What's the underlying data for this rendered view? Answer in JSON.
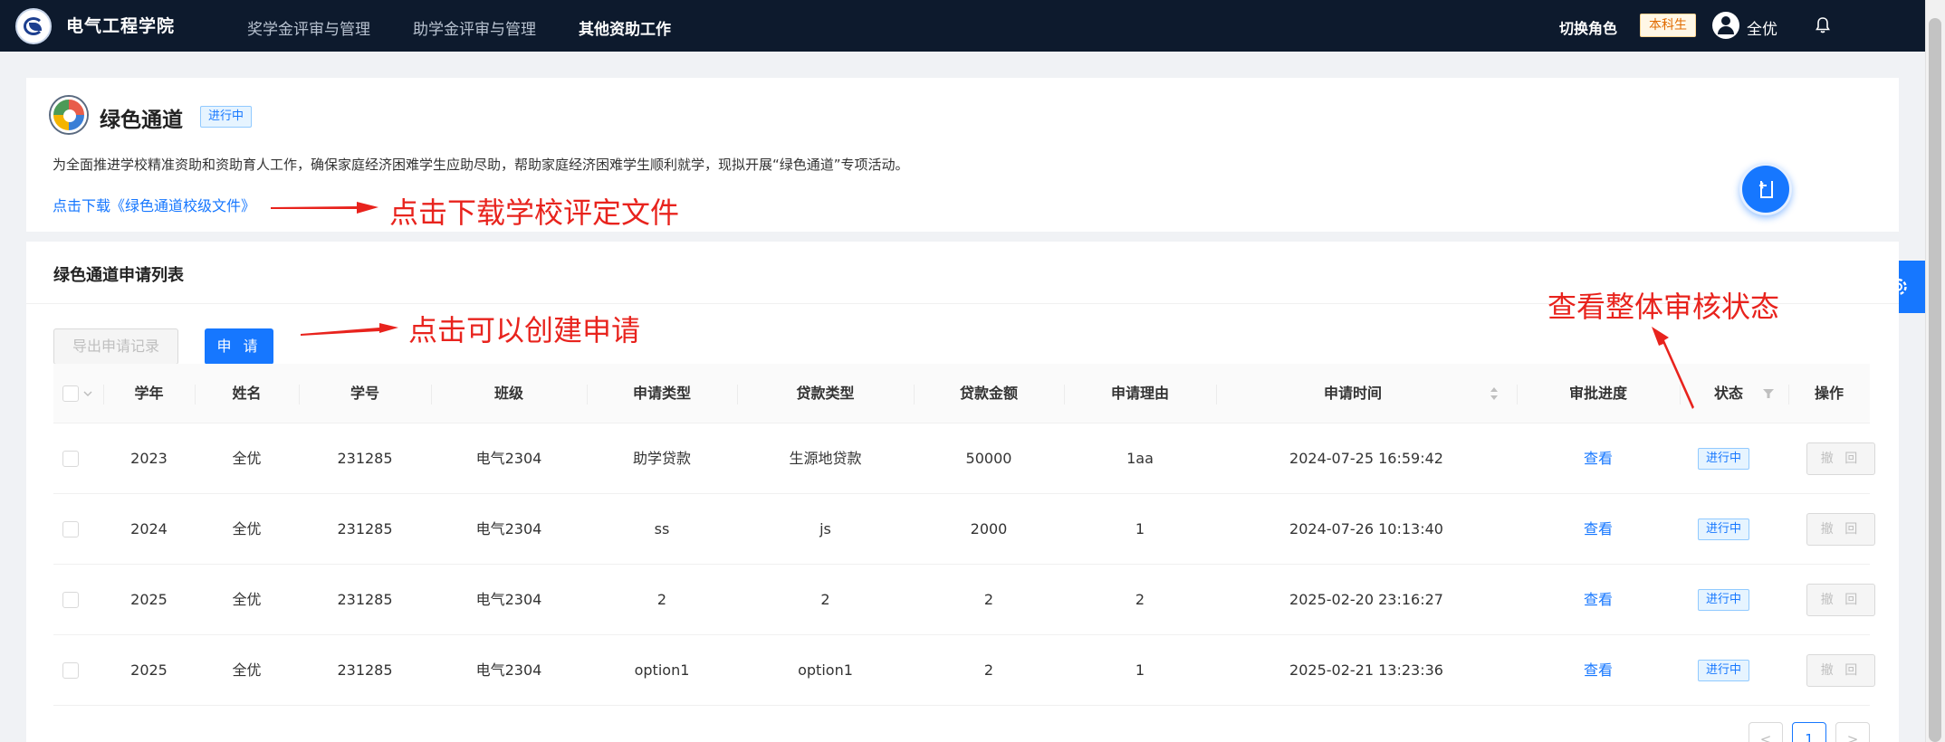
{
  "header": {
    "brand": "电气工程学院",
    "nav": [
      "奖学金评审与管理",
      "助学金评审与管理",
      "其他资助工作"
    ],
    "switch_role": "切换角色",
    "role_badge": "本科生",
    "user_name": "全优"
  },
  "program": {
    "title": "绿色通道",
    "status": "进行中",
    "description": "为全面推进学校精准资助和资助育人工作，确保家庭经济困难学生应助尽助，帮助家庭经济困难学生顺利就学，现拟开展“绿色通道”专项活动。",
    "download_link": "点击下载《绿色通道校级文件》"
  },
  "list": {
    "title": "绿色通道申请列表",
    "export_label": "导出申请记录",
    "apply_label": "申 请",
    "columns": [
      "学年",
      "姓名",
      "学号",
      "班级",
      "申请类型",
      "贷款类型",
      "贷款金额",
      "申请理由",
      "申请时间",
      "审批进度",
      "状态",
      "操作"
    ],
    "rows": [
      {
        "year": "2023",
        "name": "全优",
        "student_id": "231285",
        "class": "电气2304",
        "apply_type": "助学贷款",
        "loan_type": "生源地贷款",
        "amount": "50000",
        "reason": "1aa",
        "time": "2024-07-25 16:59:42",
        "progress": "查看",
        "status": "进行中",
        "action": "撤 回"
      },
      {
        "year": "2024",
        "name": "全优",
        "student_id": "231285",
        "class": "电气2304",
        "apply_type": "ss",
        "loan_type": "js",
        "amount": "2000",
        "reason": "1",
        "time": "2024-07-26 10:13:40",
        "progress": "查看",
        "status": "进行中",
        "action": "撤 回"
      },
      {
        "year": "2025",
        "name": "全优",
        "student_id": "231285",
        "class": "电气2304",
        "apply_type": "2",
        "loan_type": "2",
        "amount": "2",
        "reason": "2",
        "time": "2025-02-20 23:16:27",
        "progress": "查看",
        "status": "进行中",
        "action": "撤 回"
      },
      {
        "year": "2025",
        "name": "全优",
        "student_id": "231285",
        "class": "电气2304",
        "apply_type": "option1",
        "loan_type": "option1",
        "amount": "2",
        "reason": "1",
        "time": "2025-02-21 13:23:36",
        "progress": "查看",
        "status": "进行中",
        "action": "撤 回"
      }
    ],
    "pagination": {
      "current_page": "1",
      "prev": "<",
      "next": ">"
    }
  },
  "annotations": {
    "download": "点击下载学校评定文件",
    "apply": "点击可以创建申请",
    "status": "查看整体审核状态"
  },
  "colors": {
    "topbar": "#0d1a2d",
    "primary": "#1677ff",
    "annotation": "#e8231d"
  }
}
